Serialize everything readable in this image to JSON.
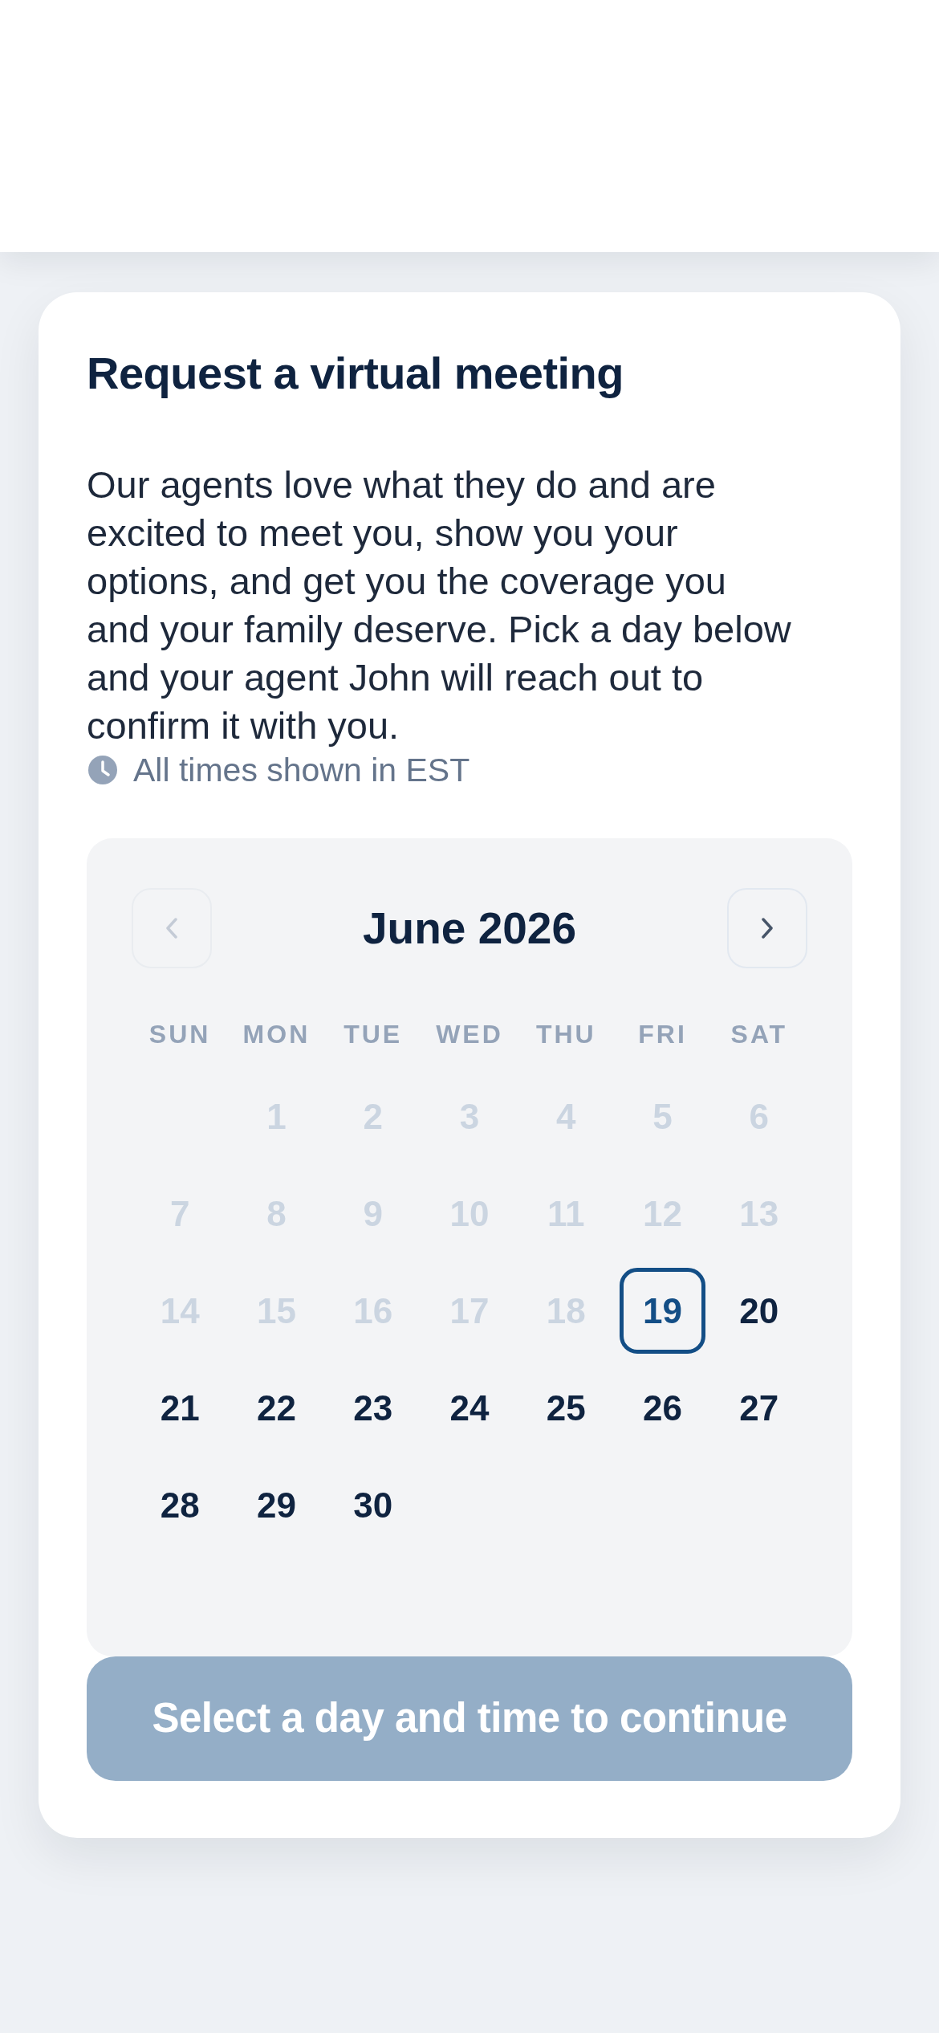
{
  "card": {
    "title": "Request a virtual meeting",
    "description": "Our agents love what they do and are excited to meet you, show you your options, and get you the coverage you and your family deserve. Pick a day below and your agent John will reach out to confirm it with you.",
    "timezone_note": "All times shown in EST"
  },
  "calendar": {
    "month": "June 2026",
    "prev": {
      "disabled": true
    },
    "next": {
      "disabled": false
    },
    "weekdays": [
      "SUN",
      "MON",
      "TUE",
      "WED",
      "THU",
      "FRI",
      "SAT"
    ],
    "days": [
      {
        "kind": "blank"
      },
      {
        "kind": "day",
        "label": "1",
        "disabled": true,
        "selected": false
      },
      {
        "kind": "day",
        "label": "2",
        "disabled": true,
        "selected": false
      },
      {
        "kind": "day",
        "label": "3",
        "disabled": true,
        "selected": false
      },
      {
        "kind": "day",
        "label": "4",
        "disabled": true,
        "selected": false
      },
      {
        "kind": "day",
        "label": "5",
        "disabled": true,
        "selected": false
      },
      {
        "kind": "day",
        "label": "6",
        "disabled": true,
        "selected": false
      },
      {
        "kind": "day",
        "label": "7",
        "disabled": true,
        "selected": false
      },
      {
        "kind": "day",
        "label": "8",
        "disabled": true,
        "selected": false
      },
      {
        "kind": "day",
        "label": "9",
        "disabled": true,
        "selected": false
      },
      {
        "kind": "day",
        "label": "10",
        "disabled": true,
        "selected": false
      },
      {
        "kind": "day",
        "label": "11",
        "disabled": true,
        "selected": false
      },
      {
        "kind": "day",
        "label": "12",
        "disabled": true,
        "selected": false
      },
      {
        "kind": "day",
        "label": "13",
        "disabled": true,
        "selected": false
      },
      {
        "kind": "day",
        "label": "14",
        "disabled": true,
        "selected": false
      },
      {
        "kind": "day",
        "label": "15",
        "disabled": true,
        "selected": false
      },
      {
        "kind": "day",
        "label": "16",
        "disabled": true,
        "selected": false
      },
      {
        "kind": "day",
        "label": "17",
        "disabled": true,
        "selected": false
      },
      {
        "kind": "day",
        "label": "18",
        "disabled": true,
        "selected": false
      },
      {
        "kind": "day",
        "label": "19",
        "disabled": false,
        "selected": true
      },
      {
        "kind": "day",
        "label": "20",
        "disabled": false,
        "selected": false
      },
      {
        "kind": "day",
        "label": "21",
        "disabled": false,
        "selected": false
      },
      {
        "kind": "day",
        "label": "22",
        "disabled": false,
        "selected": false
      },
      {
        "kind": "day",
        "label": "23",
        "disabled": false,
        "selected": false
      },
      {
        "kind": "day",
        "label": "24",
        "disabled": false,
        "selected": false
      },
      {
        "kind": "day",
        "label": "25",
        "disabled": false,
        "selected": false
      },
      {
        "kind": "day",
        "label": "26",
        "disabled": false,
        "selected": false
      },
      {
        "kind": "day",
        "label": "27",
        "disabled": false,
        "selected": false
      },
      {
        "kind": "day",
        "label": "28",
        "disabled": false,
        "selected": false
      },
      {
        "kind": "day",
        "label": "29",
        "disabled": false,
        "selected": false
      },
      {
        "kind": "day",
        "label": "30",
        "disabled": false,
        "selected": false
      }
    ]
  },
  "continue_button": {
    "label": "Select a day and time to continue",
    "disabled": true
  }
}
